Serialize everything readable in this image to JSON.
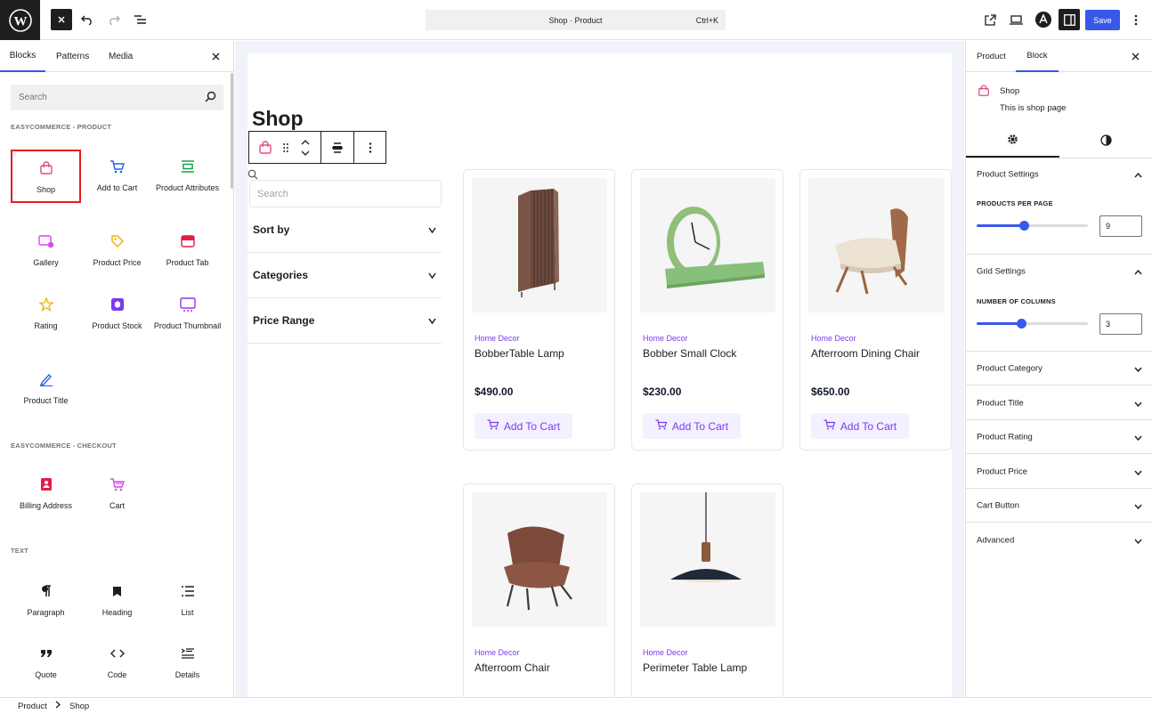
{
  "topbar": {
    "command": "Shop · Product",
    "shortcut": "Ctrl+K",
    "save_label": "Save",
    "accent_color": "#3858e9"
  },
  "inserter": {
    "tabs": [
      "Blocks",
      "Patterns",
      "Media"
    ],
    "search_placeholder": "Search",
    "categories": [
      {
        "title": "EASYCOMMERCE - PRODUCT",
        "blocks": [
          {
            "label": "Shop",
            "icon": "shopping-bag-icon"
          },
          {
            "label": "Add to Cart",
            "icon": "cart-icon"
          },
          {
            "label": "Product Attributes",
            "icon": "attributes-icon"
          },
          {
            "label": "Gallery",
            "icon": "gallery-icon"
          },
          {
            "label": "Product Price",
            "icon": "price-tag-icon"
          },
          {
            "label": "Product Tab",
            "icon": "tab-icon"
          },
          {
            "label": "Rating",
            "icon": "star-icon"
          },
          {
            "label": "Product Stock",
            "icon": "stock-box-icon"
          },
          {
            "label": "Product Thumbnail",
            "icon": "thumbnail-icon"
          },
          {
            "label": "Product Title",
            "icon": "pen-icon"
          }
        ]
      },
      {
        "title": "EASYCOMMERCE - CHECKOUT",
        "blocks": [
          {
            "label": "Billing Address",
            "icon": "address-book-icon"
          },
          {
            "label": "Cart",
            "icon": "cart-icon"
          }
        ]
      },
      {
        "title": "TEXT",
        "blocks": [
          {
            "label": "Paragraph",
            "icon": "paragraph-icon"
          },
          {
            "label": "Heading",
            "icon": "heading-icon"
          },
          {
            "label": "List",
            "icon": "list-icon"
          },
          {
            "label": "Quote",
            "icon": "quote-icon"
          },
          {
            "label": "Code",
            "icon": "code-icon"
          },
          {
            "label": "Details",
            "icon": "details-icon"
          }
        ]
      }
    ]
  },
  "canvas": {
    "title": "Shop",
    "filter_search_placeholder": "Search",
    "filters": [
      "Sort by",
      "Categories",
      "Price Range"
    ],
    "add_to_cart_label": "Add To Cart",
    "products": [
      {
        "category": "Home Decor",
        "name": "BobberTable Lamp",
        "price": "$490.00"
      },
      {
        "category": "Home Decor",
        "name": "Bobber Small Clock",
        "price": "$230.00"
      },
      {
        "category": "Home Decor",
        "name": "Afterroom Dining Chair",
        "price": "$650.00"
      },
      {
        "category": "Home Decor",
        "name": "Afterroom Chair",
        "price": ""
      },
      {
        "category": "Home Decor",
        "name": "Perimeter Table Lamp",
        "price": ""
      }
    ]
  },
  "settings": {
    "tabs": [
      "Product",
      "Block"
    ],
    "block_name": "Shop",
    "block_desc": "This is shop page",
    "panels": {
      "product_settings": "Product Settings",
      "products_per_page_label": "PRODUCTS PER PAGE",
      "products_per_page": "9",
      "products_per_page_fraction": 0.43,
      "grid_settings": "Grid Settings",
      "columns_label": "NUMBER OF COLUMNS",
      "columns": "3",
      "columns_fraction": 0.4,
      "collapsed": [
        "Product Category",
        "Product Title",
        "Product Rating",
        "Product Price",
        "Cart Button",
        "Advanced"
      ]
    }
  },
  "breadcrumb": [
    "Product",
    "Shop"
  ]
}
